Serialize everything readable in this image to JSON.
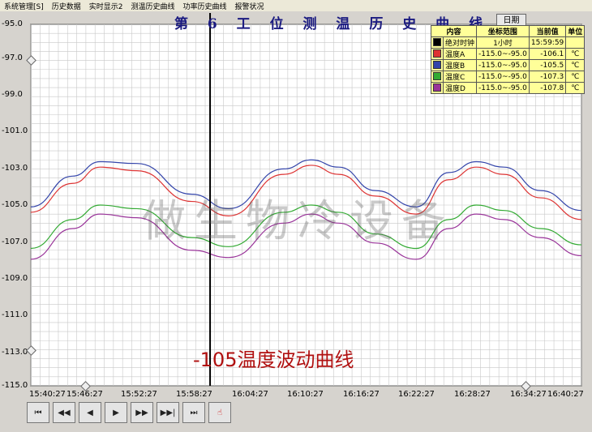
{
  "menu": [
    "系统管理[S]",
    "历史数据",
    "实时显示2",
    "测温历史曲线",
    "功率历史曲线",
    "报警状况"
  ],
  "chart_title": "第 6 工 位 测 温 历 史 曲 线",
  "date_button": "日期",
  "legend": {
    "headers": [
      "内容",
      "坐标范围",
      "当前值",
      "单位"
    ],
    "rows": [
      {
        "name": "绝对时钟",
        "range": "1小时",
        "current": "15:59:59",
        "unit": "",
        "color": "#000000"
      },
      {
        "name": "温度A",
        "range": "-115.0~-95.0",
        "current": "-106.1",
        "unit": "℃",
        "color": "#dd3333"
      },
      {
        "name": "温度B",
        "range": "-115.0~-95.0",
        "current": "-105.5",
        "unit": "℃",
        "color": "#3344aa"
      },
      {
        "name": "温度C",
        "range": "-115.0~-95.0",
        "current": "-107.3",
        "unit": "℃",
        "color": "#33aa33"
      },
      {
        "name": "温度D",
        "range": "-115.0~-95.0",
        "current": "-107.8",
        "unit": "℃",
        "color": "#993399"
      }
    ]
  },
  "caption": "-105温度波动曲线",
  "watermark": "做生物冷设备",
  "controls": [
    "first-icon",
    "prev-page-icon",
    "prev-icon",
    "play-icon",
    "next-icon",
    "next-page-icon",
    "last-icon",
    "pointer-icon"
  ],
  "chart_data": {
    "type": "line",
    "y_ticks": [
      "-95.0",
      "-97.0",
      "-99.0",
      "-101.0",
      "-103.0",
      "-105.0",
      "-107.0",
      "-109.0",
      "-111.0",
      "-113.0",
      "-115.0"
    ],
    "x_ticks": [
      "15:40:27",
      "15:46:27",
      "15:52:27",
      "15:58:27",
      "16:04:27",
      "16:10:27",
      "16:16:27",
      "16:22:27",
      "16:28:27",
      "16:34:27",
      "16:40:27"
    ],
    "ylim": [
      -115,
      -95
    ],
    "xlim": [
      "15:40:27",
      "16:40:27"
    ],
    "cursor_time": "15:59:59",
    "grid": true,
    "series": [
      {
        "name": "温度A",
        "color": "#dd3333",
        "x": [
          "15:40:27",
          "15:45:00",
          "15:48:00",
          "15:52:00",
          "15:58:00",
          "16:02:00",
          "16:08:00",
          "16:11:00",
          "16:14:00",
          "16:18:00",
          "16:22:27",
          "16:26:00",
          "16:29:00",
          "16:32:00",
          "16:36:00",
          "16:40:27"
        ],
        "y": [
          -105.4,
          -103.8,
          -102.9,
          -103.1,
          -104.8,
          -105.6,
          -103.3,
          -102.8,
          -103.3,
          -104.5,
          -105.5,
          -103.6,
          -102.9,
          -103.3,
          -104.6,
          -105.8
        ]
      },
      {
        "name": "温度B",
        "color": "#3344aa",
        "x": [
          "15:40:27",
          "15:45:00",
          "15:48:00",
          "15:52:00",
          "15:58:00",
          "16:02:00",
          "16:08:00",
          "16:11:00",
          "16:14:00",
          "16:18:00",
          "16:22:27",
          "16:26:00",
          "16:29:00",
          "16:32:00",
          "16:36:00",
          "16:40:27"
        ],
        "y": [
          -105.1,
          -103.4,
          -102.6,
          -102.7,
          -104.4,
          -105.2,
          -103.0,
          -102.5,
          -102.9,
          -104.2,
          -105.1,
          -103.2,
          -102.6,
          -102.9,
          -104.2,
          -105.3
        ]
      },
      {
        "name": "温度C",
        "color": "#33aa33",
        "x": [
          "15:40:27",
          "15:45:00",
          "15:48:00",
          "15:52:00",
          "15:58:00",
          "16:02:00",
          "16:08:00",
          "16:11:00",
          "16:14:00",
          "16:18:00",
          "16:22:27",
          "16:26:00",
          "16:29:00",
          "16:32:00",
          "16:36:00",
          "16:40:27"
        ],
        "y": [
          -107.4,
          -105.8,
          -105.0,
          -105.2,
          -106.8,
          -107.3,
          -105.4,
          -105.0,
          -105.4,
          -106.6,
          -107.4,
          -105.8,
          -105.0,
          -105.3,
          -106.3,
          -107.2
        ]
      },
      {
        "name": "温度D",
        "color": "#993399",
        "x": [
          "15:40:27",
          "15:45:00",
          "15:48:00",
          "15:52:00",
          "15:58:00",
          "16:02:00",
          "16:08:00",
          "16:11:00",
          "16:14:00",
          "16:18:00",
          "16:22:27",
          "16:26:00",
          "16:29:00",
          "16:32:00",
          "16:36:00",
          "16:40:27"
        ],
        "y": [
          -108.0,
          -106.3,
          -105.5,
          -105.7,
          -107.5,
          -107.9,
          -106.0,
          -105.5,
          -106.0,
          -107.1,
          -108.0,
          -106.3,
          -105.5,
          -105.8,
          -106.8,
          -107.8
        ]
      }
    ]
  }
}
